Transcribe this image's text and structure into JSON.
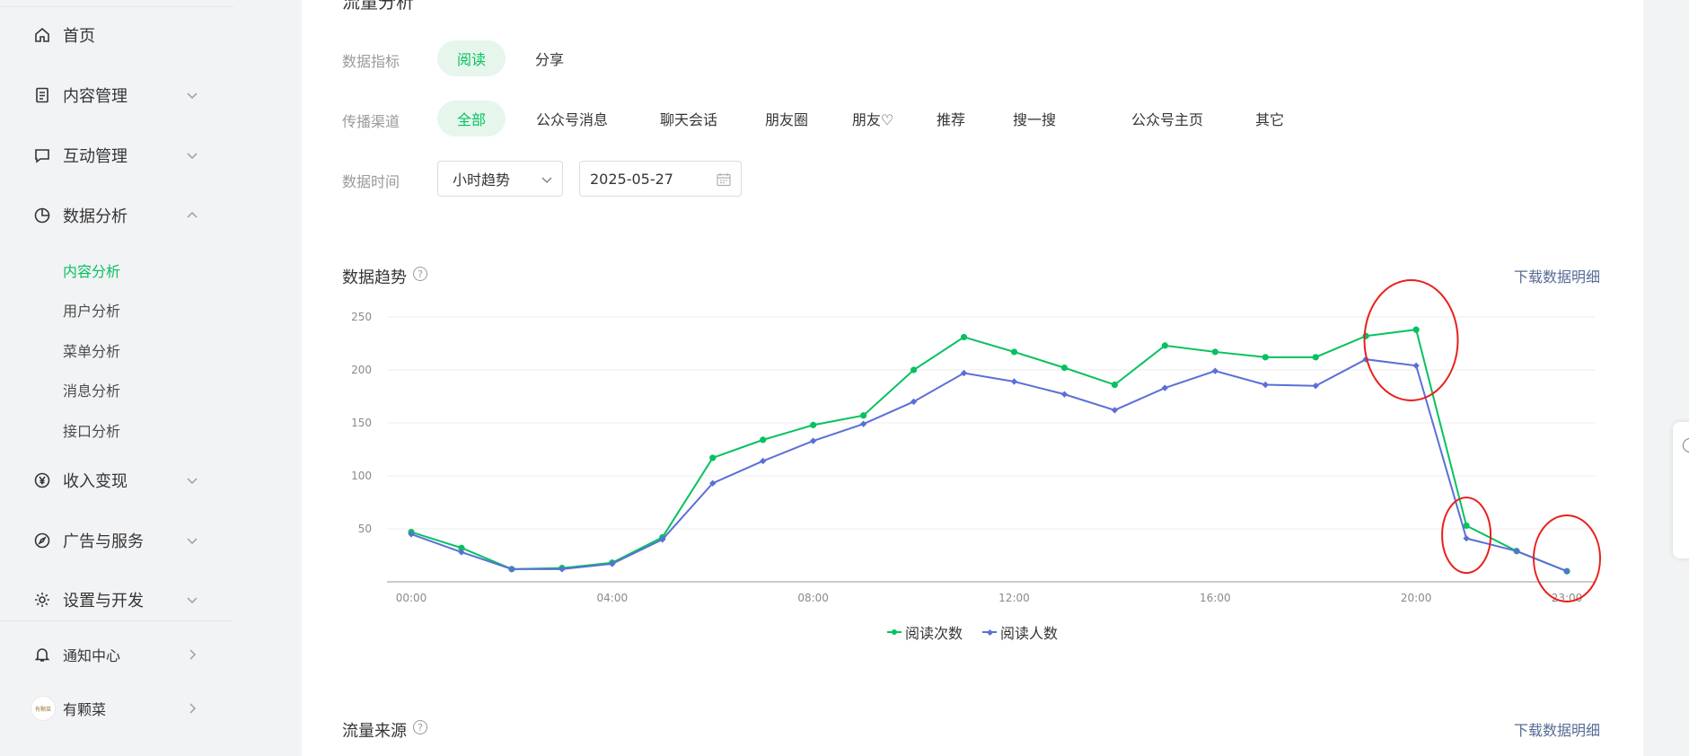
{
  "sidebar": {
    "items": [
      {
        "label": "首页",
        "icon": "home-icon",
        "chevron": ""
      },
      {
        "label": "内容管理",
        "icon": "document-icon",
        "chevron": "down"
      },
      {
        "label": "互动管理",
        "icon": "message-icon",
        "chevron": "down"
      },
      {
        "label": "数据分析",
        "icon": "pie-chart-icon",
        "chevron": "up"
      },
      {
        "label": "收入变现",
        "icon": "yen-icon",
        "chevron": "down"
      },
      {
        "label": "广告与服务",
        "icon": "compass-icon",
        "chevron": "down"
      },
      {
        "label": "设置与开发",
        "icon": "gear-icon",
        "chevron": "down"
      }
    ],
    "sub_items": [
      "内容分析",
      "用户分析",
      "菜单分析",
      "消息分析",
      "接口分析"
    ],
    "active_sub": "内容分析",
    "notification": {
      "label": "通知中心",
      "icon": "bell-icon"
    },
    "account": {
      "label": "有颗菜",
      "avatar_text": "有颗菜"
    }
  },
  "main": {
    "page_title": "流量分析",
    "filters": {
      "metric_label": "数据指标",
      "metric_options": [
        "阅读",
        "分享"
      ],
      "metric_selected": "阅读",
      "channel_label": "传播渠道",
      "channel_options": [
        "全部",
        "公众号消息",
        "聊天会话",
        "朋友圈",
        "朋友♡",
        "推荐",
        "搜一搜",
        "公众号主页",
        "其它"
      ],
      "channel_selected": "全部",
      "time_label": "数据时间",
      "time_mode": "小时趋势",
      "date": "2025-05-27"
    },
    "trend_section": {
      "title": "数据趋势",
      "download": "下载数据明细"
    },
    "source_section": {
      "title": "流量来源",
      "download": "下载数据明细"
    }
  },
  "colors": {
    "accent": "#07c160",
    "series_a": "#07c160",
    "series_b": "#5b6fd6",
    "link": "#576b95",
    "annotation": "#e8201c"
  },
  "chart_data": {
    "type": "line",
    "x": [
      "00:00",
      "01:00",
      "02:00",
      "03:00",
      "04:00",
      "05:00",
      "06:00",
      "07:00",
      "08:00",
      "09:00",
      "10:00",
      "11:00",
      "12:00",
      "13:00",
      "14:00",
      "15:00",
      "16:00",
      "17:00",
      "18:00",
      "19:00",
      "20:00",
      "21:00",
      "22:00",
      "23:00"
    ],
    "x_tick_labels": [
      "00:00",
      "04:00",
      "08:00",
      "12:00",
      "16:00",
      "20:00",
      "23:00"
    ],
    "y_ticks": [
      50,
      100,
      150,
      200,
      250
    ],
    "ylim": [
      0,
      250
    ],
    "grid": true,
    "legend": "bottom",
    "series": [
      {
        "name": "阅读次数",
        "values": [
          47,
          32,
          12,
          13,
          18,
          42,
          117,
          134,
          148,
          157,
          200,
          231,
          217,
          202,
          186,
          223,
          217,
          212,
          212,
          232,
          238,
          53,
          29,
          10
        ]
      },
      {
        "name": "阅读人数",
        "values": [
          45,
          28,
          12,
          12,
          17,
          40,
          93,
          114,
          133,
          149,
          170,
          197,
          189,
          177,
          162,
          183,
          199,
          186,
          185,
          210,
          204,
          41,
          29,
          10
        ]
      }
    ],
    "annotations": [
      {
        "shape": "ellipse",
        "around": "20:00"
      },
      {
        "shape": "ellipse",
        "around": "21:00"
      },
      {
        "shape": "ellipse",
        "around": "23:00"
      }
    ]
  }
}
